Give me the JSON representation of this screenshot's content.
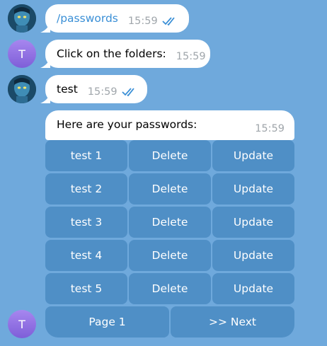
{
  "messages": [
    {
      "text": "/passwords",
      "time": "15:59"
    },
    {
      "text": "Click on the folders:",
      "time": "15:59"
    },
    {
      "text": "test",
      "time": "15:59"
    },
    {
      "text": "Here are your passwords:",
      "time": "15:59"
    }
  ],
  "bot_avatar_letter": "T",
  "keyboard": {
    "rows": [
      {
        "item": "test 1",
        "delete": "Delete",
        "update": "Update"
      },
      {
        "item": "test 2",
        "delete": "Delete",
        "update": "Update"
      },
      {
        "item": "test 3",
        "delete": "Delete",
        "update": "Update"
      },
      {
        "item": "test 4",
        "delete": "Delete",
        "update": "Update"
      },
      {
        "item": "test 5",
        "delete": "Delete",
        "update": "Update"
      }
    ],
    "page_label": "Page 1",
    "next_label": ">> Next"
  },
  "colors": {
    "background": "#6fa9dc",
    "bubble_in": "#ffffff",
    "keyboard_button": "#4f8fc6",
    "checkmark": "#3a8fd6",
    "bot_avatar": "#8c6ee0"
  },
  "icons": [
    "avatar-user-image",
    "double-check-icon"
  ]
}
